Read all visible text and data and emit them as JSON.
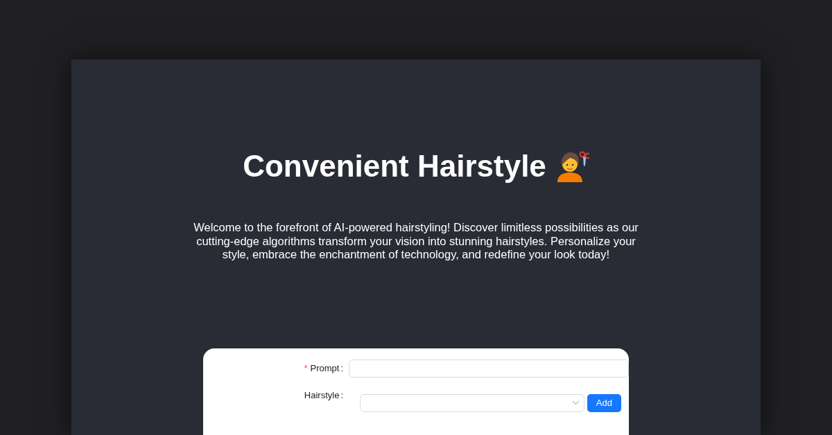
{
  "title": "Convenient Hairstyle",
  "description": "Welcome to the forefront of AI-powered hairstyling! Discover limitless possibilities as our cutting-edge algorithms transform your vision into stunning hairstyles. Personalize your style, embrace the enchantment of technology, and redefine your look today!",
  "form": {
    "fields": [
      {
        "kind": "text",
        "label": "Prompt",
        "colon": ":",
        "required": true,
        "required_mark": "*"
      },
      {
        "kind": "select",
        "label": "Hairstyle",
        "colon": ":",
        "button": "Add"
      }
    ]
  }
}
